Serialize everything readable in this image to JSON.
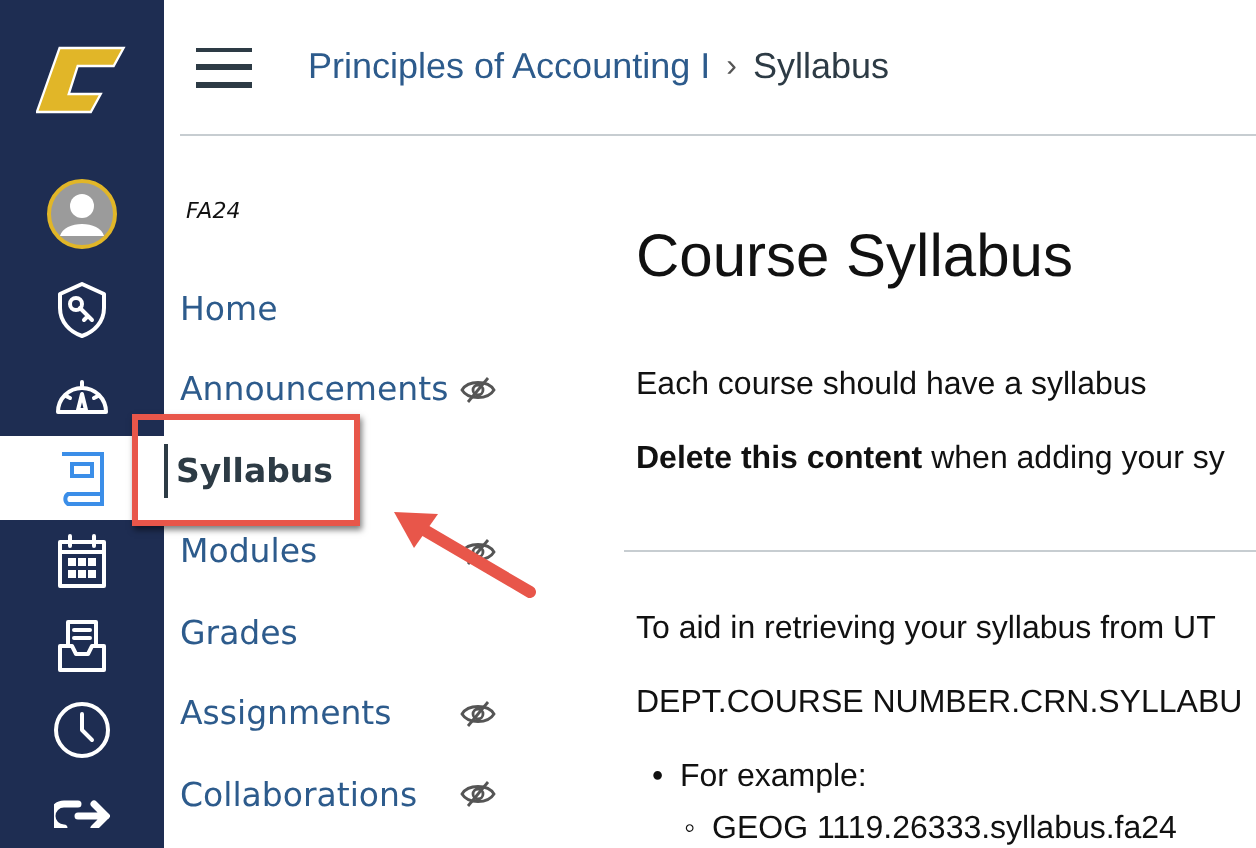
{
  "global_nav": [
    {
      "kind": "logo",
      "selected": false
    },
    {
      "kind": "account",
      "selected": false
    },
    {
      "kind": "admin",
      "selected": false
    },
    {
      "kind": "dashboard",
      "selected": false
    },
    {
      "kind": "courses",
      "selected": true
    },
    {
      "kind": "calendar",
      "selected": false
    },
    {
      "kind": "inbox",
      "selected": false
    },
    {
      "kind": "history",
      "selected": false
    },
    {
      "kind": "logout",
      "selected": false
    }
  ],
  "breadcrumb": [
    {
      "label": "Principles of Accounting I",
      "kind": "link"
    },
    {
      "label": "›",
      "kind": "separator"
    },
    {
      "label": "Syllabus",
      "kind": "current"
    }
  ],
  "course_nav": {
    "term": "FA24",
    "items": [
      {
        "label": "Home",
        "selected": false,
        "hidden": false
      },
      {
        "label": "Announcements",
        "selected": false,
        "hidden": true
      },
      {
        "label": "Syllabus",
        "selected": true,
        "hidden": false
      },
      {
        "label": "Modules",
        "selected": false,
        "hidden": true
      },
      {
        "label": "Grades",
        "selected": false,
        "hidden": false
      },
      {
        "label": "Assignments",
        "selected": false,
        "hidden": true
      },
      {
        "label": "Collaborations",
        "selected": false,
        "hidden": true
      }
    ]
  },
  "content": {
    "title": "Course Syllabus",
    "blocks": [
      {
        "kind": "paragraph",
        "text": "Each course should have a syllabus"
      },
      {
        "kind": "paragraph",
        "text": "**Delete this content** when adding your sy"
      },
      {
        "kind": "rule"
      },
      {
        "kind": "paragraph",
        "text": "To aid in retrieving your syllabus from UT"
      },
      {
        "kind": "paragraph",
        "text": "DEPT.COURSE NUMBER.CRN.SYLLABU"
      },
      {
        "kind": "list",
        "items": [
          {
            "marker": "•",
            "text": "For example:",
            "children": [
              {
                "marker": "◦",
                "text": "GEOG 1119.26333.syllabus.fa24"
              }
            ]
          }
        ]
      }
    ]
  }
}
